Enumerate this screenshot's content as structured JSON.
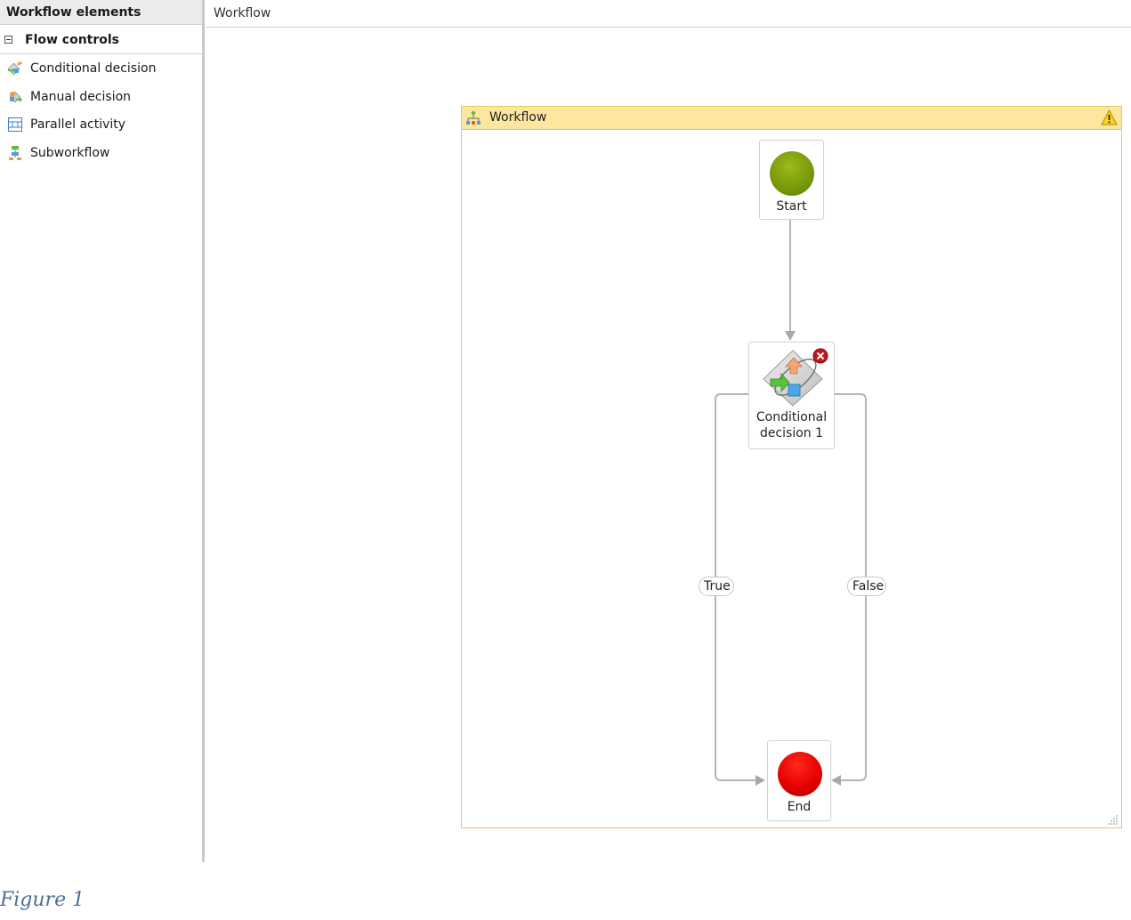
{
  "toolbox": {
    "header": "Workflow elements",
    "group": {
      "label": "Flow controls",
      "expanded": true,
      "items": [
        {
          "label": "Conditional decision",
          "icon": "conditional-decision-icon"
        },
        {
          "label": "Manual decision",
          "icon": "manual-decision-icon"
        },
        {
          "label": "Parallel activity",
          "icon": "parallel-activity-icon"
        },
        {
          "label": "Subworkflow",
          "icon": "subworkflow-icon"
        }
      ]
    }
  },
  "designer": {
    "tab_title": "Workflow",
    "container": {
      "title": "Workflow",
      "has_warning": true,
      "header_color": "#fde79e",
      "border_color": "#e7c866"
    },
    "nodes": {
      "start": {
        "label": "Start",
        "color": "#7a9a0a"
      },
      "decision": {
        "label_line1": "Conditional",
        "label_line2": "decision 1",
        "has_error": true
      },
      "end": {
        "label": "End",
        "color": "#e60000"
      }
    },
    "edges": {
      "true_label": "True",
      "false_label": "False"
    }
  },
  "caption": "Figure 1",
  "colors": {
    "caption": "#4e6e96",
    "connector": "#b5b5b5"
  }
}
